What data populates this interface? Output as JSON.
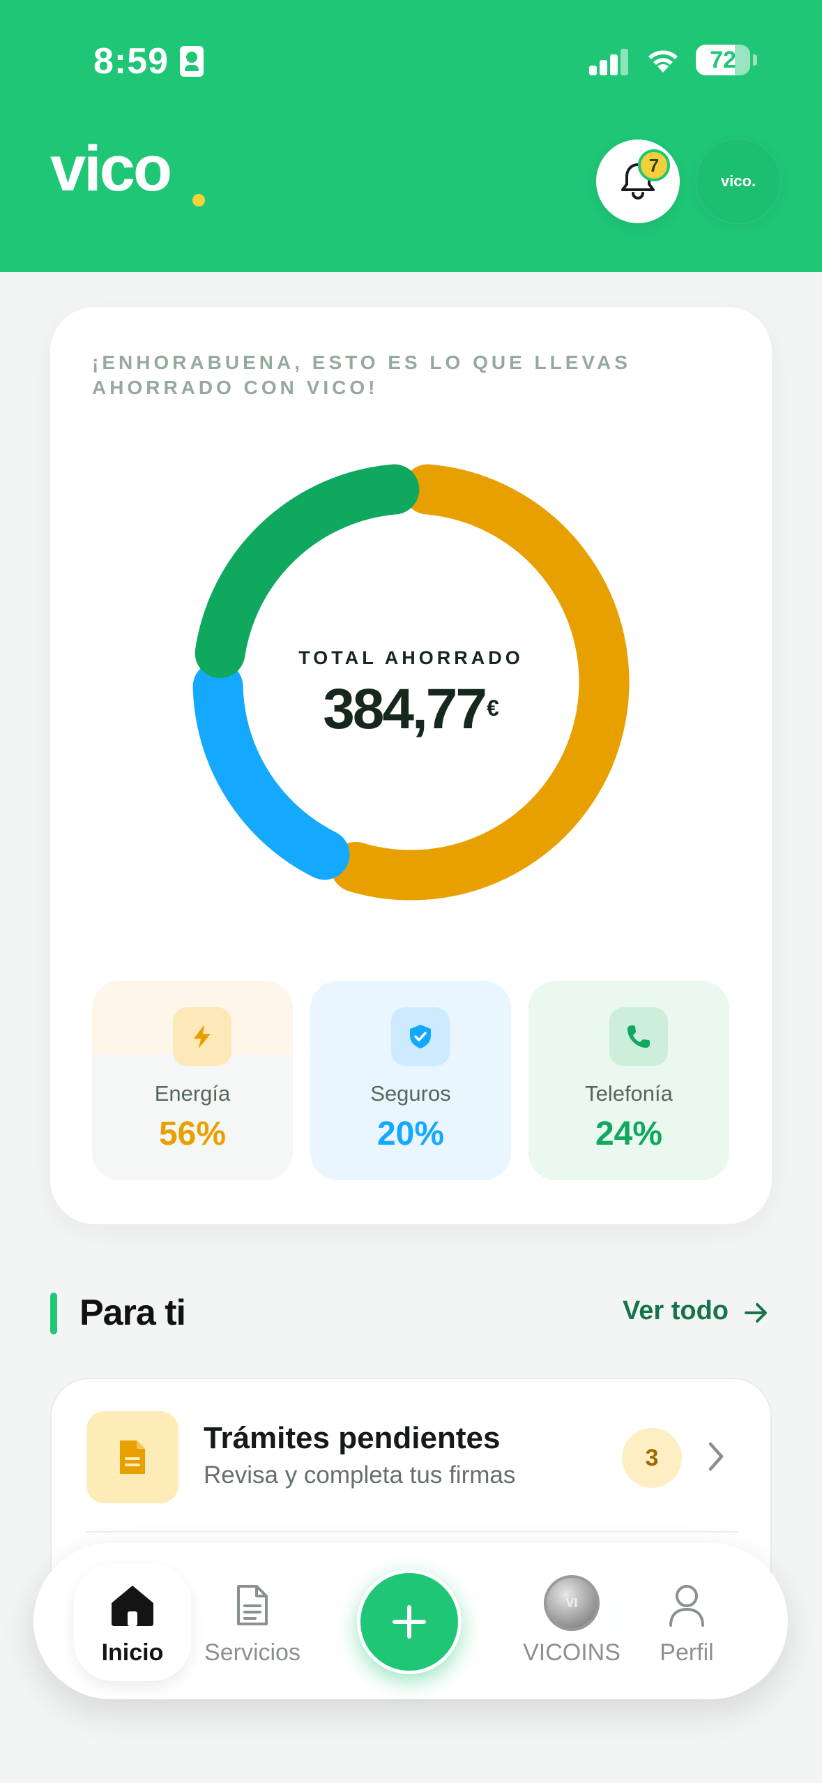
{
  "status_bar": {
    "time": "8:59",
    "battery": "72",
    "battery_level": 0.72
  },
  "header": {
    "logo_text": "vico",
    "notifications_count": "7",
    "avatar_text": "vico."
  },
  "savings": {
    "heading": "¡ENHORABUENA, ESTO ES LO QUE LLEVAS AHORRADO CON VICO!",
    "total_label": "TOTAL AHORRADO",
    "total_value": "384,77",
    "currency": "€",
    "categories": [
      {
        "name": "Energía",
        "percent": "56%",
        "value": 56,
        "color": "#e8a000",
        "icon": "bolt-icon"
      },
      {
        "name": "Seguros",
        "percent": "20%",
        "value": 20,
        "color": "#14a8ff",
        "icon": "shield-check-icon"
      },
      {
        "name": "Telefonía",
        "percent": "24%",
        "value": 24,
        "color": "#0fa85e",
        "icon": "phone-icon"
      }
    ]
  },
  "para_ti": {
    "title": "Para ti",
    "see_all": "Ver todo",
    "pending": {
      "title": "Trámites pendientes",
      "subtitle": "Revisa y completa tus firmas",
      "count": "3"
    }
  },
  "nav": {
    "items": [
      {
        "label": "Inicio",
        "icon": "home-icon",
        "active": true
      },
      {
        "label": "Servicios",
        "icon": "document-icon"
      },
      {
        "label": "",
        "icon": "plus-icon"
      },
      {
        "label": "VICOINS",
        "icon": "coin-icon"
      },
      {
        "label": "Perfil",
        "icon": "user-icon"
      }
    ]
  }
}
